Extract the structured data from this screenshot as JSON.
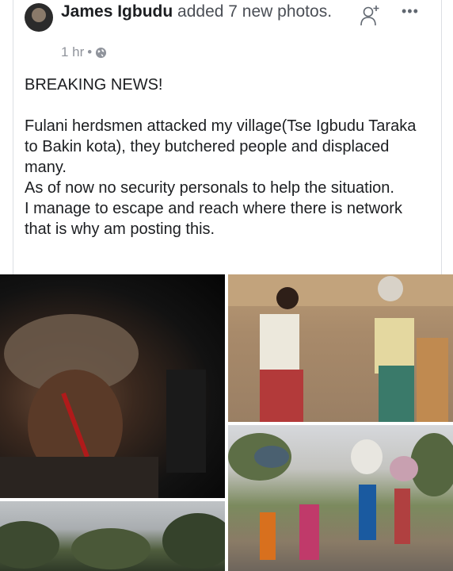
{
  "post": {
    "author": "James Igbudu",
    "action": " added 7 new photos.",
    "time": "1 hr",
    "separator": "•",
    "privacy_icon": "globe-icon",
    "add_friend_icon": "add-friend-icon",
    "more_label": "•••",
    "body": [
      "BREAKING NEWS!",
      "",
      "Fulani herdsmen attacked my village(Tse Igbudu Taraka to Bakin kota), they butchered people and displaced many.",
      "As of now no security personals to help the situation.",
      "I manage to escape and reach where there is network that is why am posting this."
    ]
  },
  "photos": {
    "count": 4,
    "colors": {
      "card_border": "#dcdfe3",
      "meta": "#90949c",
      "text": "#1c1e21"
    }
  }
}
